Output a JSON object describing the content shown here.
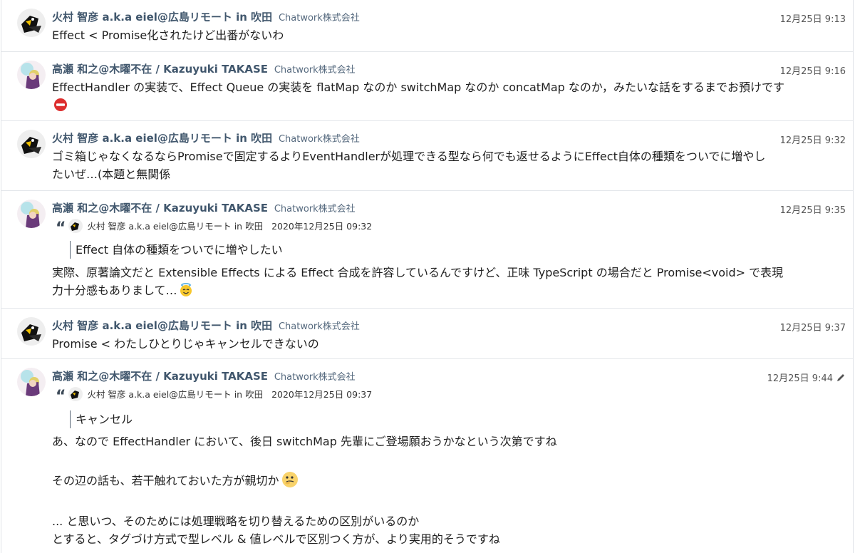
{
  "org_label": "Chatwork株式会社",
  "messages": [
    {
      "sender": "火村 智彦 a.k.a eiel@広島リモート in 吹田",
      "time": "12月25日 9:13",
      "lines": [
        "Effect <  Promise化されたけど出番がないわ"
      ]
    },
    {
      "sender": "高瀬 和之@木曜不在 / Kazuyuki TAKASE",
      "time": "12月25日 9:16",
      "lines": [
        "EffectHandler の実装で、Effect Queue の実装を flatMap なのか switchMap なのか concatMap なのか，みたいな話をするまでお預けです"
      ],
      "emoji": "no-entry-icon"
    },
    {
      "sender": "火村 智彦 a.k.a eiel@広島リモート in 吹田",
      "time": "12月25日 9:32",
      "lines": [
        "ゴミ箱じゃなくなるならPromiseで固定するよりEventHandlerが処理できる型なら何でも返せるようにEffect自体の種類をついでに増やし",
        "たいぜ…(本題と無関係"
      ]
    },
    {
      "sender": "高瀬 和之@木曜不在 / Kazuyuki TAKASE",
      "time": "12月25日 9:35",
      "quote": {
        "author": "火村 智彦 a.k.a eiel@広島リモート in 吹田",
        "date": "2020年12月25日 09:32",
        "text": "Effect 自体の種類をついでに増やしたい"
      },
      "lines": [
        "実際、原著論文だと Extensible Effects による Effect 合成を許容しているんですけど、正味 TypeScript の場合だと Promise<void> で表現",
        "力十分感もありまして…"
      ],
      "emoji": "smiling-halo-face-icon"
    },
    {
      "sender": "火村 智彦 a.k.a eiel@広島リモート in 吹田",
      "time": "12月25日 9:37",
      "lines": [
        "Promise < わたしひとりじゃキャンセルできないの"
      ]
    },
    {
      "sender": "高瀬 和之@木曜不在 / Kazuyuki TAKASE",
      "time": "12月25日 9:44",
      "edited": true,
      "quote": {
        "author": "火村 智彦 a.k.a eiel@広島リモート in 吹田",
        "date": "2020年12月25日 09:37",
        "text": "キャンセル"
      },
      "lines": [
        "あ、なので EffectHandler において、後日 switchMap 先輩にご登場願おうかなという次第ですね",
        "",
        "その辺の話も、若干触れておいた方が親切か",
        "",
        "... と思いつ、そのためには処理戦略を切り替えるための区別がいるのか",
        "とすると、タグづけ方式で型レベル & 値レベルで区別つく方が、より実用的そうですね"
      ],
      "inline_emoji": "thinking-face-icon"
    }
  ]
}
